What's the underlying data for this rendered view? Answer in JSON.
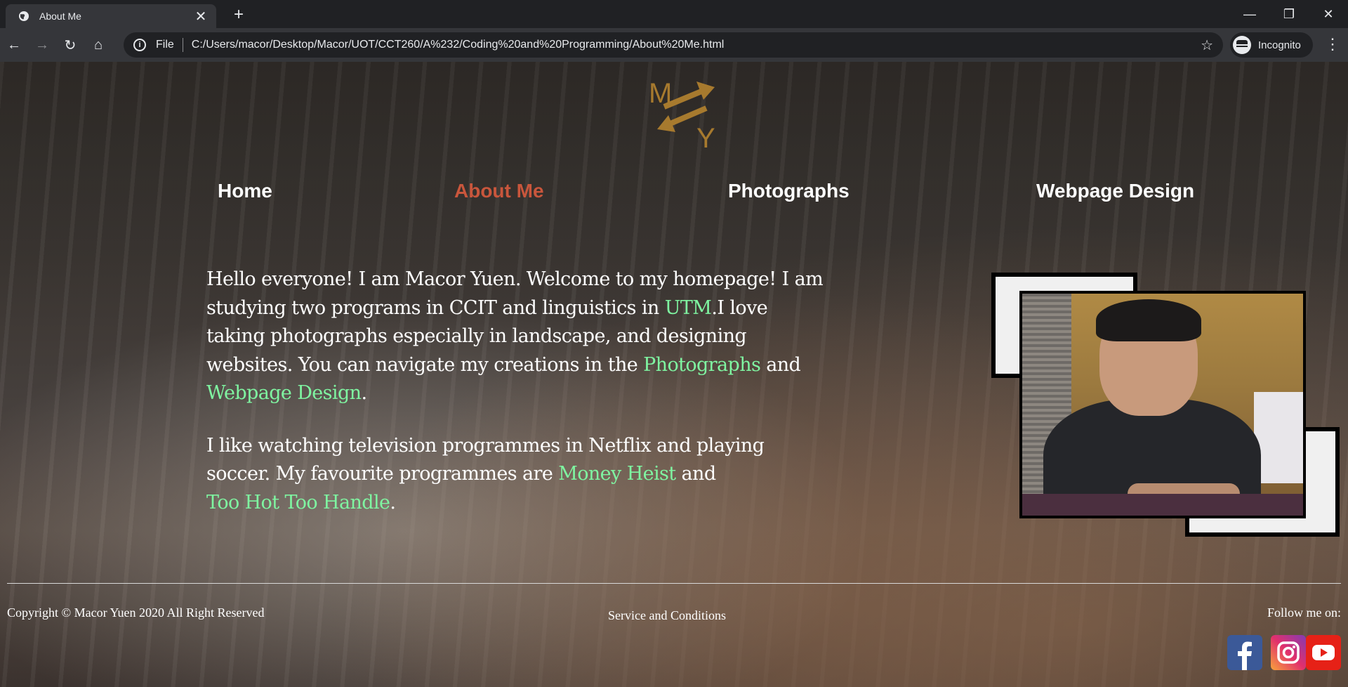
{
  "browser": {
    "tab_title": "About Me",
    "tab_close": "✕",
    "new_tab": "+",
    "window_controls": {
      "minimize": "—",
      "restore": "❐",
      "close": "✕"
    },
    "nav": {
      "back": "←",
      "forward": "→",
      "reload": "↻",
      "home": "⌂"
    },
    "omnibox": {
      "info": "i",
      "scheme": "File",
      "url": "C:/Users/macor/Desktop/Macor/UOT/CCT260/A%232/Coding%20and%20Programming/About%20Me.html",
      "star": "☆"
    },
    "profile_label": "Incognito",
    "menu": "⋮"
  },
  "site": {
    "logo": {
      "letter_top": "M",
      "letter_bottom": "Y",
      "color": "#a77a2e"
    },
    "nav": [
      {
        "label": "Home",
        "active": false
      },
      {
        "label": "About Me",
        "active": true
      },
      {
        "label": "Photographs",
        "active": false
      },
      {
        "label": "Webpage Design",
        "active": false
      }
    ],
    "intro": {
      "p1": {
        "t1": "Hello everyone! I am Macor Yuen. Welcome to my homepage! I am studying two programs in CCIT and linguistics in ",
        "link1": "UTM",
        "t2": ".I love taking photographs especially in landscape, and designing websites. You can navigate my creations in the ",
        "link2": "Photographs",
        "t3": " and ",
        "link3": "Webpage Design",
        "t4": "."
      },
      "p2": {
        "t1": "I like watching television programmes in Netflix and playing soccer. My favourite programmes are ",
        "link1": "Money Heist",
        "t2": " and ",
        "link2": "Too Hot Too Handle",
        "t3": "."
      }
    },
    "footer": {
      "copyright": "Copyright © Macor Yuen 2020 All Right Reserved",
      "service": "Service and Conditions",
      "follow": "Follow me on:",
      "social": [
        {
          "name": "facebook",
          "glyph": "f"
        },
        {
          "name": "instagram",
          "glyph": "◎"
        },
        {
          "name": "youtube",
          "glyph": "▶"
        }
      ]
    },
    "colors": {
      "accent_active": "#c9563c",
      "link": "#7ff5a1"
    }
  }
}
